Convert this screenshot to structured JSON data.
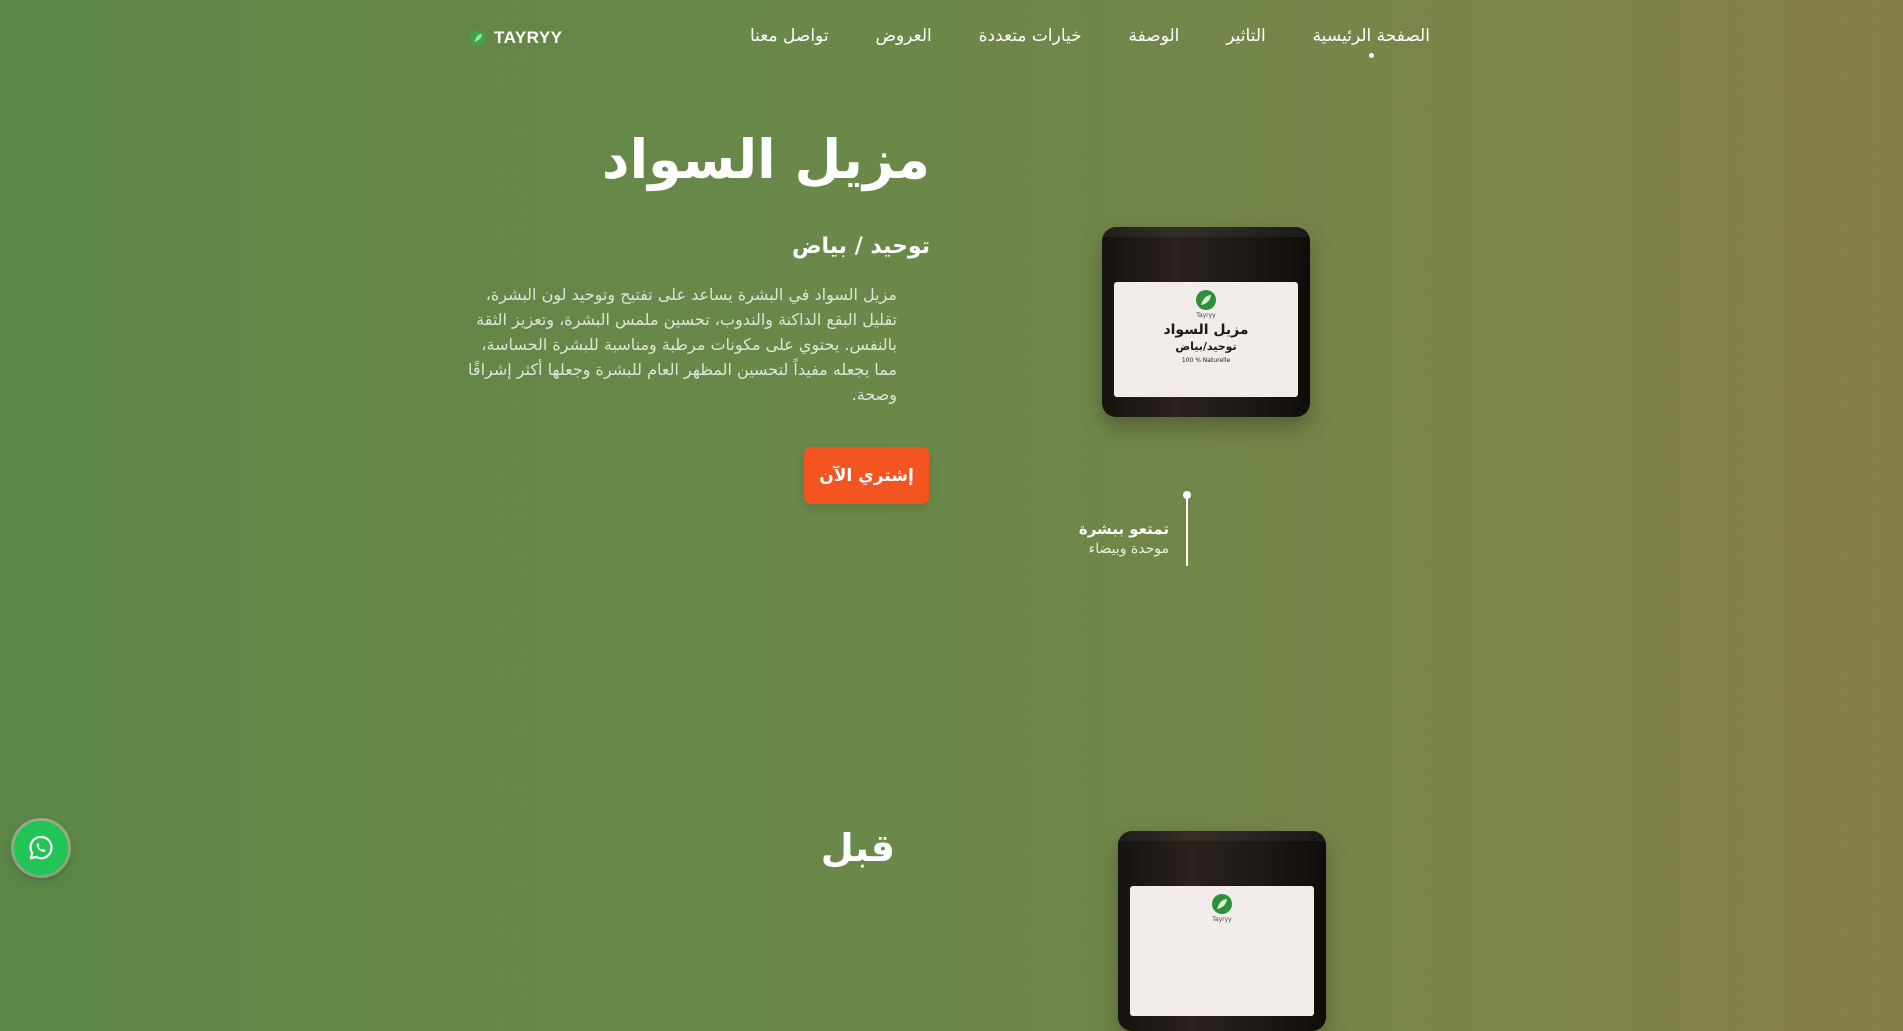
{
  "header": {
    "brand": "TAYRYY",
    "nav": [
      {
        "label": "الصفحة الرئيسية",
        "active": true
      },
      {
        "label": "التاثير",
        "active": false
      },
      {
        "label": "الوصفة",
        "active": false
      },
      {
        "label": "خيارات متعددة",
        "active": false
      },
      {
        "label": "العروض",
        "active": false
      },
      {
        "label": "تواصل معنا",
        "active": false
      }
    ]
  },
  "hero": {
    "title": "مزيل السواد",
    "subtitle": "توحيد / بياض",
    "description": "مزيل السواد في البشرة يساعد على تفتيح وتوحيد لون البشرة، تقليل البقع الداكنة والندوب، تحسين ملمس البشرة، وتعزيز الثقة بالنفس. يحتوي على مكونات مرطبة ومناسبة للبشرة الحساسة، مما يجعله مفيداً لتحسين المظهر العام للبشرة وجعلها أكثر إشراقًا وصحة.",
    "cta_label": "إشتري الآن"
  },
  "product_label": {
    "brand": "Tayryy",
    "title": "مزيل السواد",
    "subtitle": "توحيد/بياض",
    "note": "100 % Naturelle"
  },
  "feature": {
    "title": "تمتعو ببشرة",
    "text": "موحدة وبيضاء"
  },
  "section2": {
    "title": "قبل"
  },
  "colors": {
    "accent": "#f4541f",
    "whatsapp": "#23c456",
    "background_start": "#5b8648",
    "background_end": "#847f47"
  },
  "icons": {
    "brand": "leaf-icon",
    "floating_button": "whatsapp-icon"
  }
}
